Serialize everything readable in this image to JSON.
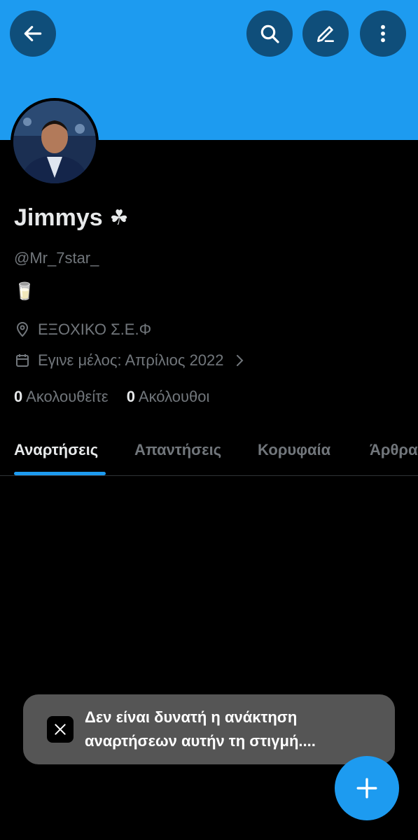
{
  "profile": {
    "display_name": "Jimmys",
    "name_emoji": "☘",
    "handle": "@Mr_7star_",
    "bio": "🥛",
    "location": "ΕΞΟΧΙΚΟ Σ.Ε.Φ",
    "joined": "Εγινε μέλος: Απρίλιος 2022",
    "following_count": "0",
    "following_label": "Ακολουθείτε",
    "followers_count": "0",
    "followers_label": "Ακόλουθοι"
  },
  "tabs": [
    {
      "label": "Αναρτήσεις",
      "active": true
    },
    {
      "label": "Απαντήσεις",
      "active": false
    },
    {
      "label": "Κορυφαία",
      "active": false
    },
    {
      "label": "Άρθρα",
      "active": false
    }
  ],
  "toast": {
    "line1": "Δεν είναι δυνατή η ανάκτηση",
    "line2": "αναρτήσεων αυτήν τη στιγμή...."
  },
  "colors": {
    "accent": "#1d9bf0",
    "background": "#000000",
    "secondary_text": "#71767b"
  },
  "icons": [
    "back-arrow-icon",
    "search-icon",
    "edit-icon",
    "more-vertical-icon",
    "location-pin-icon",
    "calendar-icon",
    "chevron-right-icon",
    "x-logo-icon",
    "plus-icon"
  ]
}
